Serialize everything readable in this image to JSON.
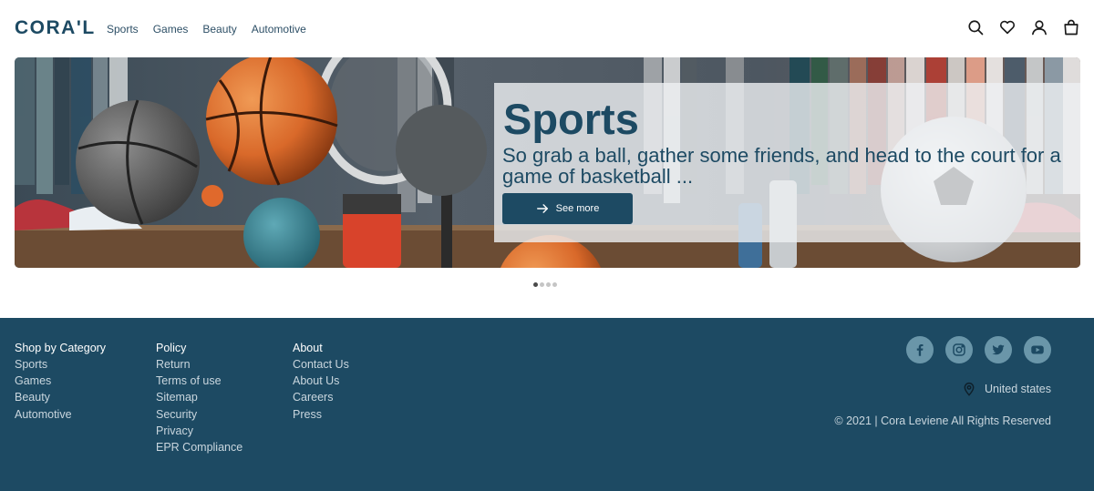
{
  "header": {
    "logo": "CORA'L",
    "nav": [
      "Sports",
      "Games",
      "Beauty",
      "Automotive"
    ],
    "icons": [
      "search-icon",
      "heart-icon",
      "user-icon",
      "bag-icon"
    ]
  },
  "hero": {
    "title": "Sports",
    "description": "So grab a ball, gather some friends, and head to the court for a game of basketball ...",
    "button_label": "See more",
    "slide_count": 4,
    "active_slide": 1
  },
  "footer": {
    "columns": [
      {
        "heading": "Shop by Category",
        "links": [
          "Sports",
          "Games",
          "Beauty",
          "Automotive"
        ]
      },
      {
        "heading": "Policy",
        "links": [
          "Return",
          "Terms of use",
          "Sitemap",
          "Security",
          "Privacy",
          "EPR Compliance"
        ]
      },
      {
        "heading": "About",
        "links": [
          "Contact Us",
          "About Us",
          "Careers",
          "Press"
        ]
      }
    ],
    "social": [
      "facebook-icon",
      "instagram-icon",
      "twitter-icon",
      "youtube-icon"
    ],
    "location": "United states",
    "copyright": "© 2021 | Cora Leviene All Rights Reserved"
  },
  "colors": {
    "primary": "#1d4a63",
    "social_bg": "#6a96a9",
    "footer_text": "#c9d6de"
  }
}
